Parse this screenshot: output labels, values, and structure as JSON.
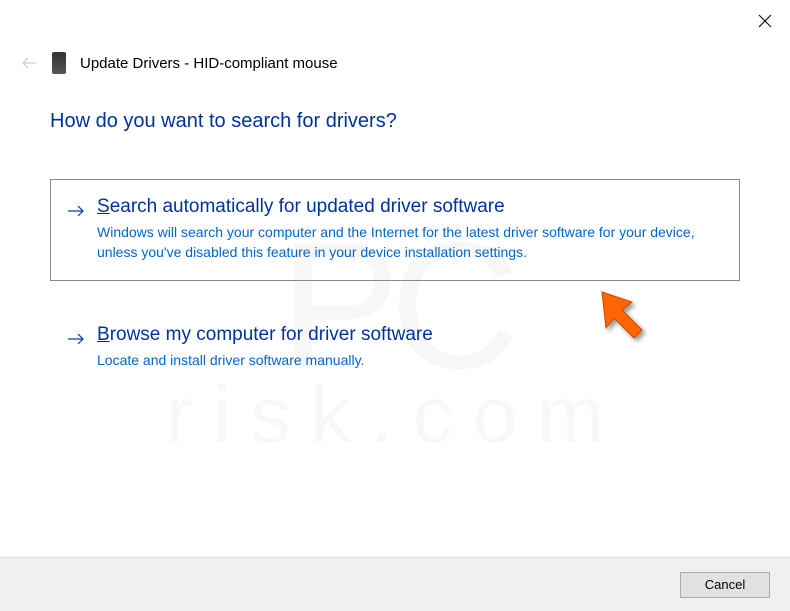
{
  "header": {
    "title": "Update Drivers - HID-compliant mouse"
  },
  "heading": "How do you want to search for drivers?",
  "options": {
    "search": {
      "accesskey": "S",
      "title_rest": "earch automatically for updated driver software",
      "description": "Windows will search your computer and the Internet for the latest driver software for your device, unless you've disabled this feature in your device installation settings."
    },
    "browse": {
      "accesskey": "B",
      "title_rest": "rowse my computer for driver software",
      "description": "Locate and install driver software manually."
    }
  },
  "footer": {
    "cancel_label": "Cancel"
  },
  "watermark": {
    "main": "PC",
    "sub": "risk.com"
  }
}
